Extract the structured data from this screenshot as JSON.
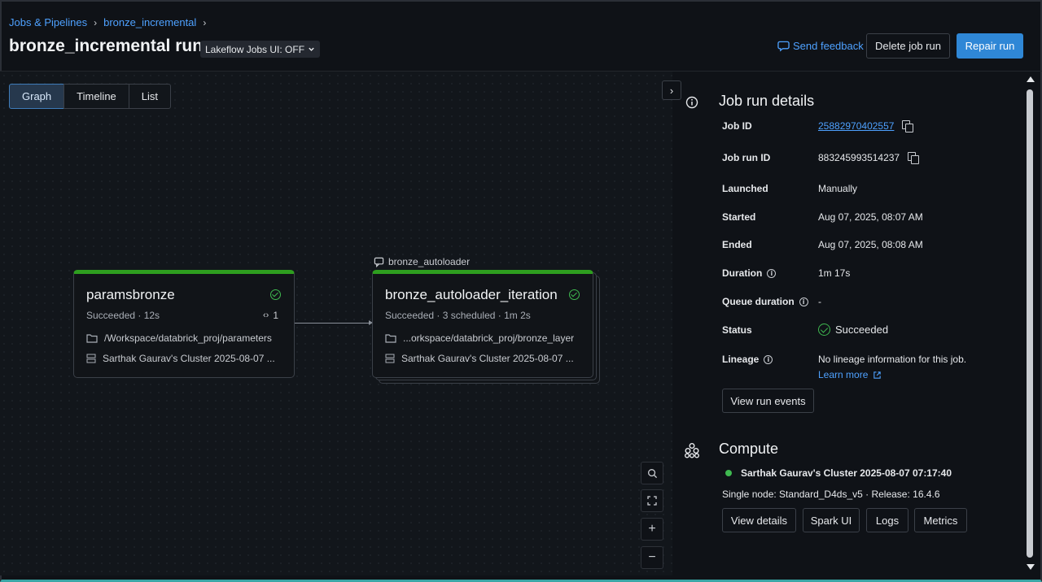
{
  "breadcrumb": {
    "items": [
      "Jobs & Pipelines",
      "bronze_incremental"
    ]
  },
  "header": {
    "title": "bronze_incremental run",
    "lakeflow_toggle": "Lakeflow Jobs UI: OFF",
    "send_feedback": "Send feedback",
    "delete_button": "Delete job run",
    "repair_button": "Repair run"
  },
  "view_tabs": [
    "Graph",
    "Timeline",
    "List"
  ],
  "tasks": [
    {
      "name": "paramsbronze",
      "status": "Succeeded",
      "meta": "Succeeded · 12s",
      "param_count": "1",
      "path": "/Workspace/databrick_proj/parameters",
      "cluster": "Sarthak Gaurav's Cluster 2025-08-07 ..."
    },
    {
      "loop_label": "bronze_autoloader",
      "name": "bronze_autoloader_iteration",
      "status": "Succeeded",
      "meta": "Succeeded · 3 scheduled · 1m 2s",
      "path": "...orkspace/databrick_proj/bronze_layer",
      "cluster": "Sarthak Gaurav's Cluster 2025-08-07 ..."
    }
  ],
  "details": {
    "title": "Job run details",
    "job_id_label": "Job ID",
    "job_id": "25882970402557",
    "run_id_label": "Job run ID",
    "run_id": "883245993514237",
    "launched_label": "Launched",
    "launched": "Manually",
    "started_label": "Started",
    "started": "Aug 07, 2025, 08:07 AM",
    "ended_label": "Ended",
    "ended": "Aug 07, 2025, 08:08 AM",
    "duration_label": "Duration",
    "duration": "1m 17s",
    "queue_label": "Queue duration",
    "queue": "-",
    "status_label": "Status",
    "status": "Succeeded",
    "lineage_label": "Lineage",
    "lineage": "No lineage information for this job.",
    "learn_more": "Learn more",
    "view_events": "View run events"
  },
  "compute": {
    "title": "Compute",
    "cluster_name": "Sarthak Gaurav's Cluster 2025-08-07 07:17:40",
    "spec": "Single node: Standard_D4ds_v5 · Release: 16.4.6",
    "buttons": [
      "View details",
      "Spark UI",
      "Logs",
      "Metrics"
    ]
  },
  "colors": {
    "accent": "#4ea1ff",
    "success": "#3fb950",
    "primary": "#2f87d6"
  }
}
